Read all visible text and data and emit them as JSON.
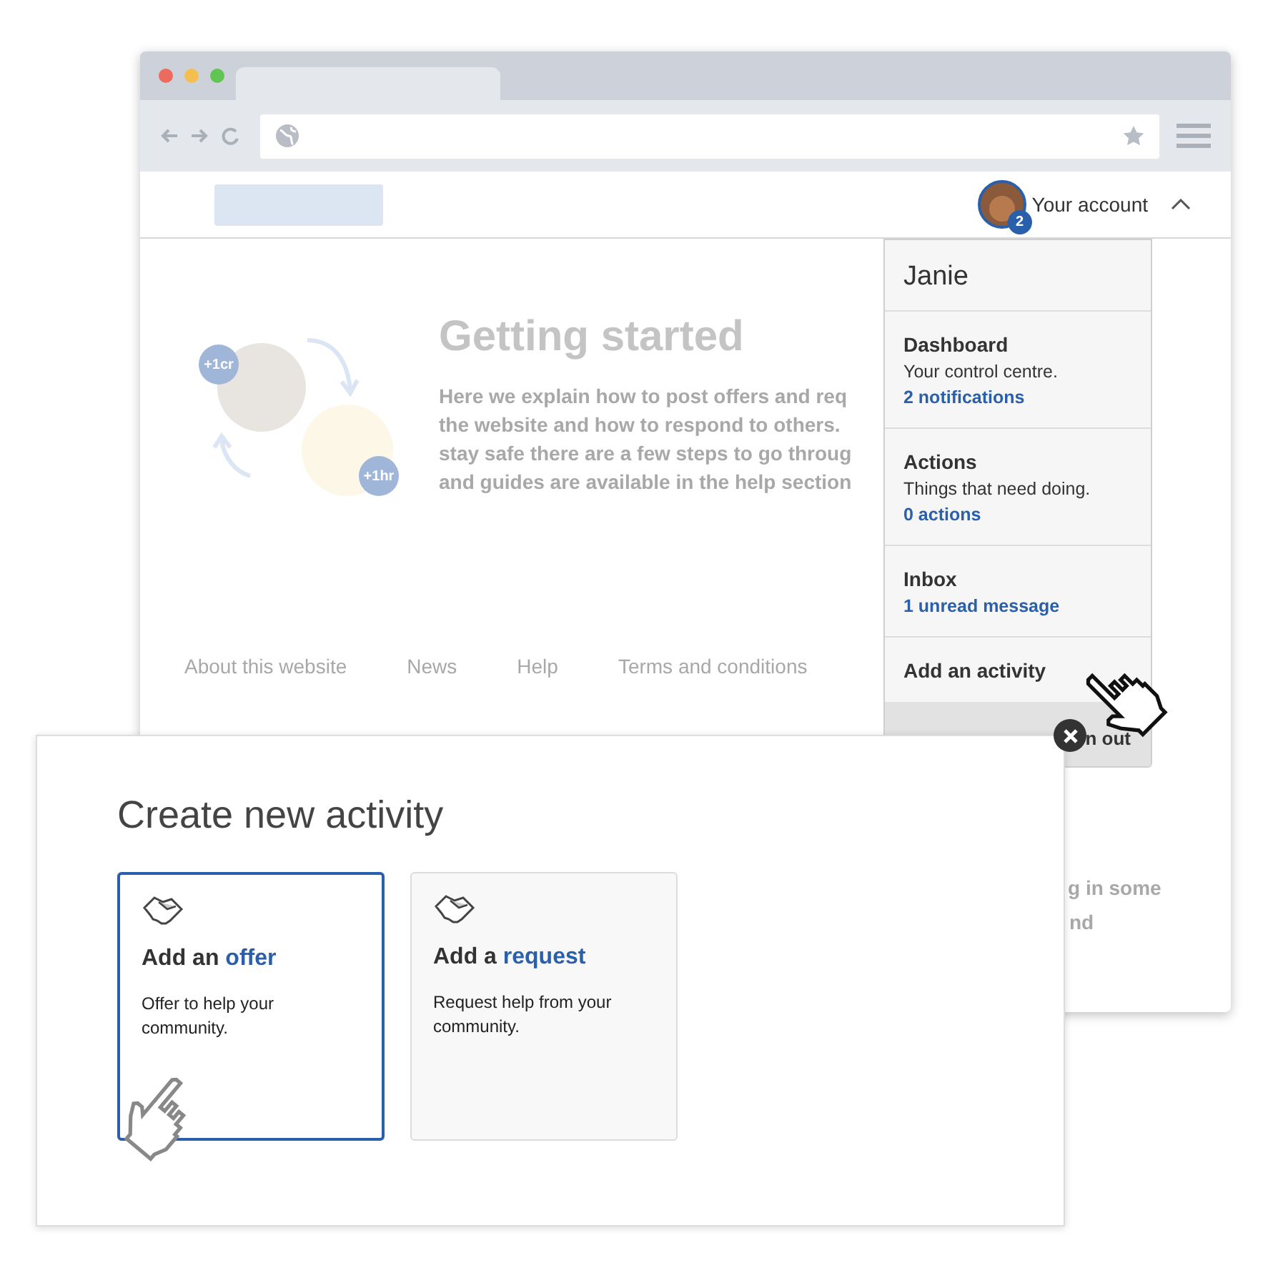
{
  "browser": {
    "site": {
      "account": {
        "label": "Your account",
        "badge": "2",
        "expanded": true
      }
    },
    "intro": {
      "title": "Getting started",
      "badges": [
        "+1cr",
        "+1hr"
      ],
      "lines": [
        "Here we explain how to post offers and req",
        "the website and how to respond to others.",
        "stay safe there are a few steps to go throug",
        "and guides are available in the help section"
      ]
    },
    "footer_links": [
      "About this website",
      "News",
      "Help",
      "Terms and conditions"
    ],
    "uncovered_fragments": [
      "g in some",
      "nd"
    ]
  },
  "account_menu": {
    "name": "Janie",
    "sections": [
      {
        "title": "Dashboard",
        "text": "Your control centre.",
        "link": "2 notifications"
      },
      {
        "title": "Actions",
        "text": "Things that need doing.",
        "link": "0 actions"
      },
      {
        "title": "Inbox",
        "link": "1 unread message"
      },
      {
        "title": "Add an activity"
      }
    ],
    "footer": [
      "n out"
    ]
  },
  "modal": {
    "title": "Create new activity",
    "options": [
      {
        "prefix": "Add an",
        "keyword": "offer",
        "text": "Offer to help your community.",
        "selected": true
      },
      {
        "prefix": "Add a",
        "keyword": "request",
        "text": "Request help from your community.",
        "selected": false
      }
    ]
  }
}
